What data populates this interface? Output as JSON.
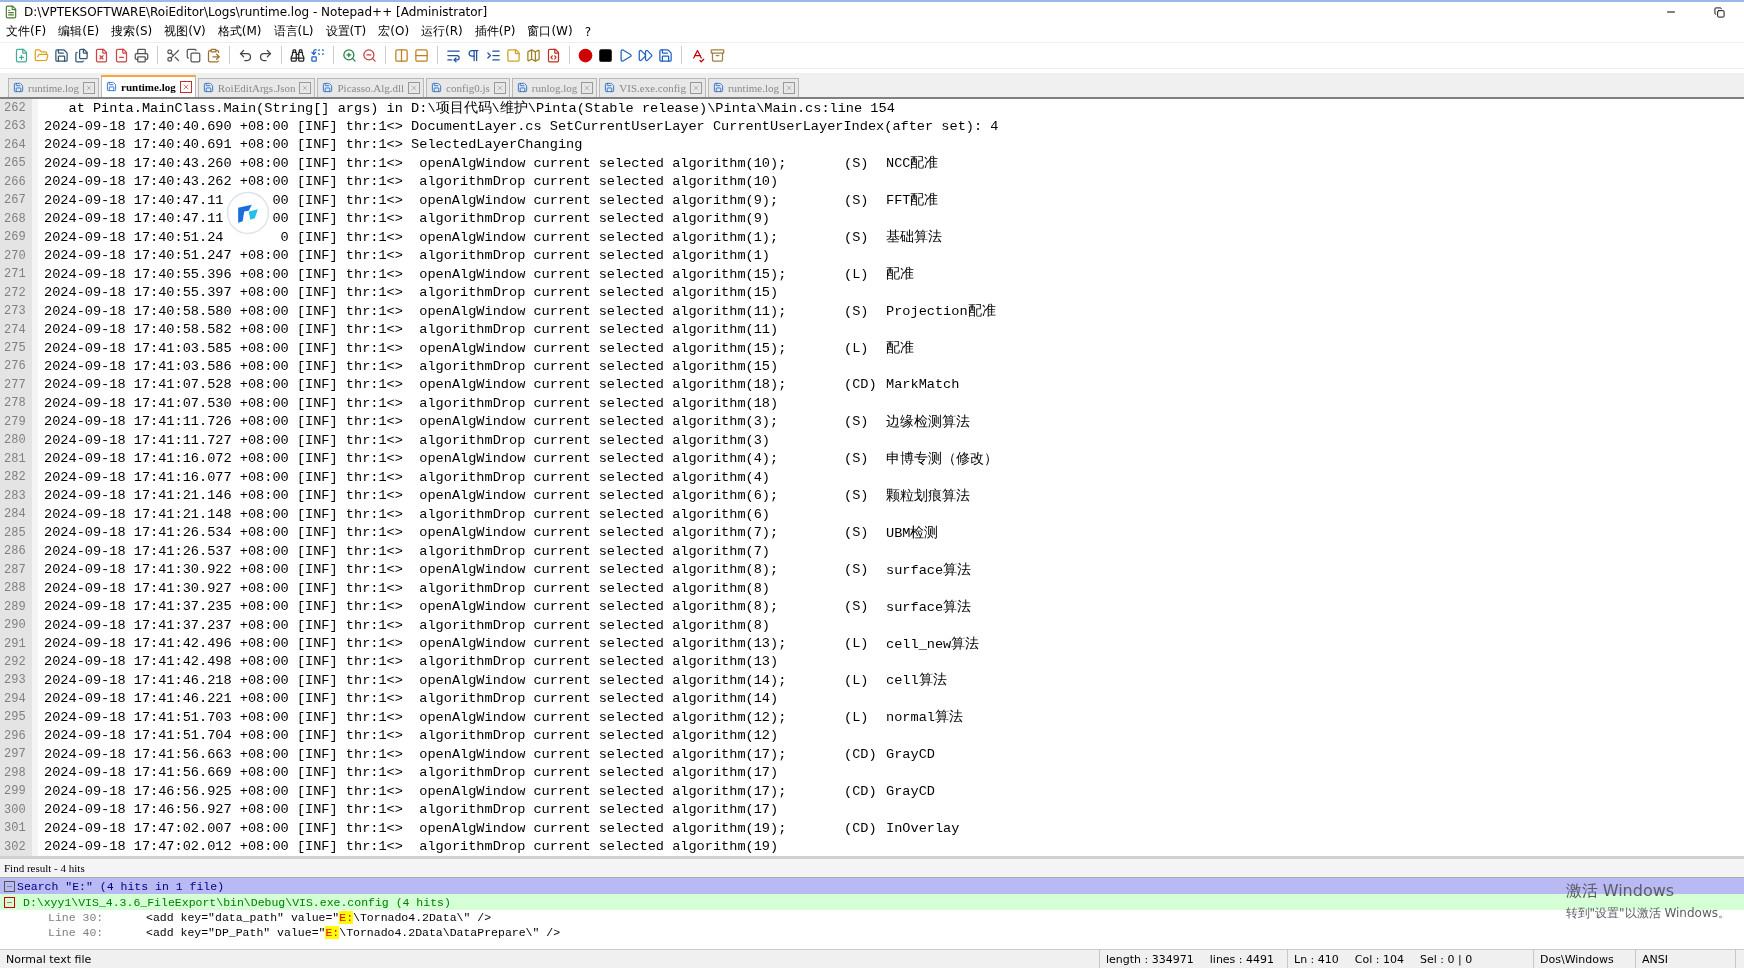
{
  "window": {
    "title": "D:\\VPTEKSOFTWARE\\RoiEditor\\Logs\\runtime.log - Notepad++ [Administrator]"
  },
  "menu": [
    "文件(F)",
    "编辑(E)",
    "搜索(S)",
    "视图(V)",
    "格式(M)",
    "语言(L)",
    "设置(T)",
    "宏(O)",
    "运行(R)",
    "插件(P)",
    "窗口(W)",
    "?"
  ],
  "tabs": [
    {
      "label": "runtime.log",
      "selected": false
    },
    {
      "label": "runtime.log",
      "selected": true
    },
    {
      "label": "RoiEditArgs.Json",
      "selected": false
    },
    {
      "label": "Picasso.Alg.dll",
      "selected": false
    },
    {
      "label": "config0.js",
      "selected": false
    },
    {
      "label": "runlog.log",
      "selected": false
    },
    {
      "label": "VIS.exe.config",
      "selected": false
    },
    {
      "label": "runtime.log",
      "selected": false
    }
  ],
  "lines": [
    {
      "n": "262",
      "text": "   at Pinta.MainClass.Main(String[] args) in D:\\项目代码\\维护\\Pinta(Stable release)\\Pinta\\Main.cs:line 154"
    },
    {
      "n": "263",
      "text": "2024-09-18 17:40:40.690 +08:00 [INF] thr:1<> DocumentLayer.cs SetCurrentUserLayer CurrentUserLayerIndex(after set): 4"
    },
    {
      "n": "264",
      "text": "2024-09-18 17:40:40.691 +08:00 [INF] thr:1<> SelectedLayerChanging"
    },
    {
      "n": "265",
      "text": "2024-09-18 17:40:43.260 +08:00 [INF] thr:1<>  openAlgWindow current selected algorithm(10);",
      "tag": "(S)",
      "name": "NCC配准"
    },
    {
      "n": "266",
      "text": "2024-09-18 17:40:43.262 +08:00 [INF] thr:1<>  algorithmDrop current selected algorithm(10)"
    },
    {
      "n": "267",
      "text": "2024-09-18 17:40:47.11",
      "tail": "00 [INF] thr:1<>  openAlgWindow current selected algorithm(9);",
      "tag": "(S)",
      "name": "FFT配准"
    },
    {
      "n": "268",
      "text": "2024-09-18 17:40:47.11",
      "tail": "00 [INF] thr:1<>  algorithmDrop current selected algorithm(9)"
    },
    {
      "n": "269",
      "text": "2024-09-18 17:40:51.24",
      "tail": "0 [INF] thr:1<>  openAlgWindow current selected algorithm(1);",
      "tag": "(S)",
      "name": "基础算法"
    },
    {
      "n": "270",
      "text": "2024-09-18 17:40:51.247 +08:00 [INF] thr:1<>  algorithmDrop current selected algorithm(1)"
    },
    {
      "n": "271",
      "text": "2024-09-18 17:40:55.396 +08:00 [INF] thr:1<>  openAlgWindow current selected algorithm(15);",
      "tag": "(L)",
      "name": "配准"
    },
    {
      "n": "272",
      "text": "2024-09-18 17:40:55.397 +08:00 [INF] thr:1<>  algorithmDrop current selected algorithm(15)"
    },
    {
      "n": "273",
      "text": "2024-09-18 17:40:58.580 +08:00 [INF] thr:1<>  openAlgWindow current selected algorithm(11);",
      "tag": "(S)",
      "name": "Projection配准"
    },
    {
      "n": "274",
      "text": "2024-09-18 17:40:58.582 +08:00 [INF] thr:1<>  algorithmDrop current selected algorithm(11)"
    },
    {
      "n": "275",
      "text": "2024-09-18 17:41:03.585 +08:00 [INF] thr:1<>  openAlgWindow current selected algorithm(15);",
      "tag": "(L)",
      "name": "配准"
    },
    {
      "n": "276",
      "text": "2024-09-18 17:41:03.586 +08:00 [INF] thr:1<>  algorithmDrop current selected algorithm(15)"
    },
    {
      "n": "277",
      "text": "2024-09-18 17:41:07.528 +08:00 [INF] thr:1<>  openAlgWindow current selected algorithm(18);",
      "tag": "(CD)",
      "name": "MarkMatch"
    },
    {
      "n": "278",
      "text": "2024-09-18 17:41:07.530 +08:00 [INF] thr:1<>  algorithmDrop current selected algorithm(18)"
    },
    {
      "n": "279",
      "text": "2024-09-18 17:41:11.726 +08:00 [INF] thr:1<>  openAlgWindow current selected algorithm(3);",
      "tag": "(S)",
      "name": "边缘检测算法"
    },
    {
      "n": "280",
      "text": "2024-09-18 17:41:11.727 +08:00 [INF] thr:1<>  algorithmDrop current selected algorithm(3)"
    },
    {
      "n": "281",
      "text": "2024-09-18 17:41:16.072 +08:00 [INF] thr:1<>  openAlgWindow current selected algorithm(4);",
      "tag": "(S)",
      "name": "申博专测（修改）"
    },
    {
      "n": "282",
      "text": "2024-09-18 17:41:16.077 +08:00 [INF] thr:1<>  algorithmDrop current selected algorithm(4)"
    },
    {
      "n": "283",
      "text": "2024-09-18 17:41:21.146 +08:00 [INF] thr:1<>  openAlgWindow current selected algorithm(6);",
      "tag": "(S)",
      "name": "颗粒划痕算法"
    },
    {
      "n": "284",
      "text": "2024-09-18 17:41:21.148 +08:00 [INF] thr:1<>  algorithmDrop current selected algorithm(6)"
    },
    {
      "n": "285",
      "text": "2024-09-18 17:41:26.534 +08:00 [INF] thr:1<>  openAlgWindow current selected algorithm(7);",
      "tag": "(S)",
      "name": "UBM检测"
    },
    {
      "n": "286",
      "text": "2024-09-18 17:41:26.537 +08:00 [INF] thr:1<>  algorithmDrop current selected algorithm(7)"
    },
    {
      "n": "287",
      "text": "2024-09-18 17:41:30.922 +08:00 [INF] thr:1<>  openAlgWindow current selected algorithm(8);",
      "tag": "(S)",
      "name": "surface算法"
    },
    {
      "n": "288",
      "text": "2024-09-18 17:41:30.927 +08:00 [INF] thr:1<>  algorithmDrop current selected algorithm(8)"
    },
    {
      "n": "289",
      "text": "2024-09-18 17:41:37.235 +08:00 [INF] thr:1<>  openAlgWindow current selected algorithm(8);",
      "tag": "(S)",
      "name": "surface算法"
    },
    {
      "n": "290",
      "text": "2024-09-18 17:41:37.237 +08:00 [INF] thr:1<>  algorithmDrop current selected algorithm(8)"
    },
    {
      "n": "291",
      "text": "2024-09-18 17:41:42.496 +08:00 [INF] thr:1<>  openAlgWindow current selected algorithm(13);",
      "tag": "(L)",
      "name": "cell_new算法"
    },
    {
      "n": "292",
      "text": "2024-09-18 17:41:42.498 +08:00 [INF] thr:1<>  algorithmDrop current selected algorithm(13)"
    },
    {
      "n": "293",
      "text": "2024-09-18 17:41:46.218 +08:00 [INF] thr:1<>  openAlgWindow current selected algorithm(14);",
      "tag": "(L)",
      "name": "cell算法"
    },
    {
      "n": "294",
      "text": "2024-09-18 17:41:46.221 +08:00 [INF] thr:1<>  algorithmDrop current selected algorithm(14)"
    },
    {
      "n": "295",
      "text": "2024-09-18 17:41:51.703 +08:00 [INF] thr:1<>  openAlgWindow current selected algorithm(12);",
      "tag": "(L)",
      "name": "normal算法"
    },
    {
      "n": "296",
      "text": "2024-09-18 17:41:51.704 +08:00 [INF] thr:1<>  algorithmDrop current selected algorithm(12)"
    },
    {
      "n": "297",
      "text": "2024-09-18 17:41:56.663 +08:00 [INF] thr:1<>  openAlgWindow current selected algorithm(17);",
      "tag": "(CD)",
      "name": "GrayCD"
    },
    {
      "n": "298",
      "text": "2024-09-18 17:41:56.669 +08:00 [INF] thr:1<>  algorithmDrop current selected algorithm(17)"
    },
    {
      "n": "299",
      "text": "2024-09-18 17:46:56.925 +08:00 [INF] thr:1<>  openAlgWindow current selected algorithm(17);",
      "tag": "(CD)",
      "name": "GrayCD"
    },
    {
      "n": "300",
      "text": "2024-09-18 17:46:56.927 +08:00 [INF] thr:1<>  algorithmDrop current selected algorithm(17)"
    },
    {
      "n": "301",
      "text": "2024-09-18 17:47:02.007 +08:00 [INF] thr:1<>  openAlgWindow current selected algorithm(19);",
      "tag": "(CD)",
      "name": "InOverlay"
    },
    {
      "n": "302",
      "text": "2024-09-18 17:47:02.012 +08:00 [INF] thr:1<>  algorithmDrop current selected algorithm(19)"
    }
  ],
  "find_result": {
    "title": "Find result - 4 hits",
    "search": "Search \"E:\" (4 hits in 1 file)",
    "file": "D:\\xyy1\\VIS_4.3.6_FileExport\\bin\\Debug\\VIS.exe.config (4 hits)",
    "hits": [
      {
        "line": "Line 30:",
        "before": "<add key=\"data_path\" value=\"",
        "match": "E:",
        "after": "\\Tornado4.2Data\\\" />"
      },
      {
        "line": "Line 40:",
        "before": "<add key=\"DP_Path\" value=\"",
        "match": "E:",
        "after": "\\Tornado4.2Data\\DataPrepare\\\" />"
      }
    ]
  },
  "os_overlay": {
    "title": "激活 Windows",
    "hint": "转到\"设置\"以激活 Windows。"
  },
  "status_bar": {
    "type": "Normal text file",
    "length": "length : 334971",
    "lines": "lines : 4491",
    "ln": "Ln : 410",
    "col": "Col : 104",
    "sel": "Sel : 0 | 0",
    "eol": "Dos\\Windows",
    "encoding": "ANSI"
  }
}
